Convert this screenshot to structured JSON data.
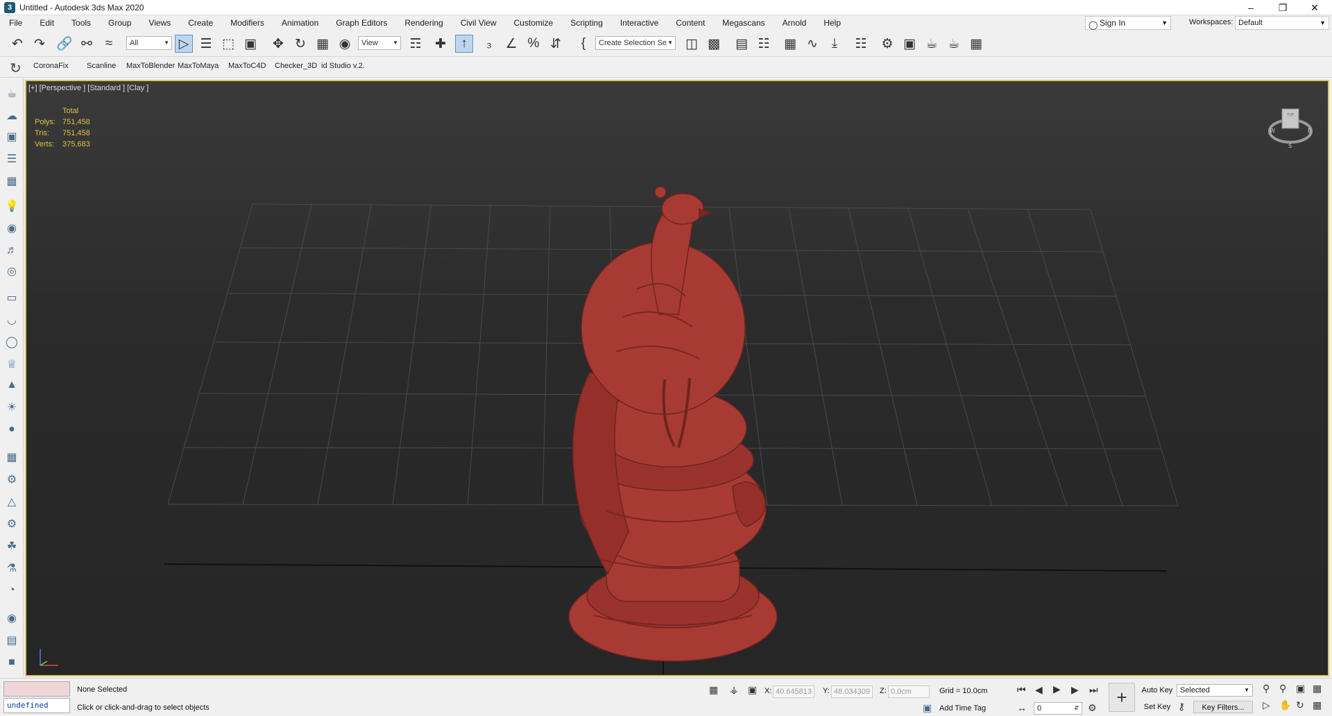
{
  "window": {
    "title": "Untitled - Autodesk 3ds Max 2020",
    "app_icon": "3"
  },
  "menu": [
    "File",
    "Edit",
    "Tools",
    "Group",
    "Views",
    "Create",
    "Modifiers",
    "Animation",
    "Graph Editors",
    "Rendering",
    "Civil View",
    "Customize",
    "Scripting",
    "Interactive",
    "Content",
    "Megascans",
    "Arnold",
    "Help"
  ],
  "account": {
    "signin_label": "Sign In",
    "workspaces_label": "Workspaces:",
    "workspace_value": "Default"
  },
  "toolbar": {
    "selection_filter": "All",
    "ref_coord": "View",
    "named_selection": "Create Selection Se"
  },
  "plugins": [
    "CoronaFix",
    "Scanline",
    "MaxToBlender",
    "MaxToMaya",
    "MaxToC4D",
    "Checker_3D",
    "id Studio v.2."
  ],
  "viewport": {
    "label": "[+] [Perspective ] [Standard ] [Clay ]",
    "stats": {
      "header": "Total",
      "rows": [
        {
          "label": "Polys:",
          "value": "751,458"
        },
        {
          "label": "Tris:",
          "value": "751,458"
        },
        {
          "label": "Verts:",
          "value": "375,683"
        }
      ]
    },
    "viewcube": {
      "top": "TOP",
      "west": "W",
      "east": "E",
      "south": "S"
    }
  },
  "status": {
    "maxscript_value": "undefined",
    "selection": "None Selected",
    "prompt": "Click or click-and-drag to select objects",
    "x_label": "X:",
    "x_value": "40.645813",
    "y_label": "Y:",
    "y_value": "48.034309",
    "z_label": "Z:",
    "z_value": "0.0cm",
    "grid": "Grid = 10.0cm",
    "add_time_tag": "Add Time Tag",
    "auto_key": "Auto Key",
    "set_key": "Set Key",
    "key_mode": "Selected",
    "key_filters": "Key Filters...",
    "frame": "0"
  },
  "colors": {
    "accent": "#e0c55a",
    "model": "#a83a34",
    "stats_text": "#e0c33c"
  }
}
